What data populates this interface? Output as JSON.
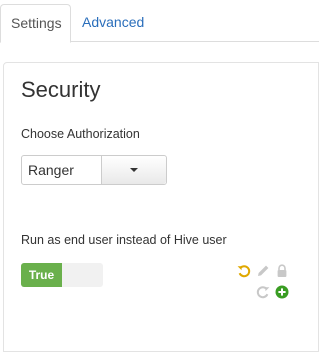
{
  "tabs": [
    {
      "label": "Settings",
      "active": true
    },
    {
      "label": "Advanced",
      "active": false
    }
  ],
  "panel": {
    "title": "Security",
    "authorization": {
      "label": "Choose Authorization",
      "selected": "Ranger"
    },
    "run_as_end_user": {
      "label": "Run as end user instead of Hive user",
      "toggle_label": "True",
      "value": true
    }
  },
  "actions": {
    "icons": [
      "undo-icon",
      "edit-icon",
      "lock-icon",
      "redo-icon",
      "add-icon"
    ]
  },
  "colors": {
    "tab_link": "#2a6ebb",
    "toggle_on": "#6ab04c",
    "undo": "#e0a800",
    "add": "#3a9d23",
    "muted_icon": "#c8c8c8"
  }
}
